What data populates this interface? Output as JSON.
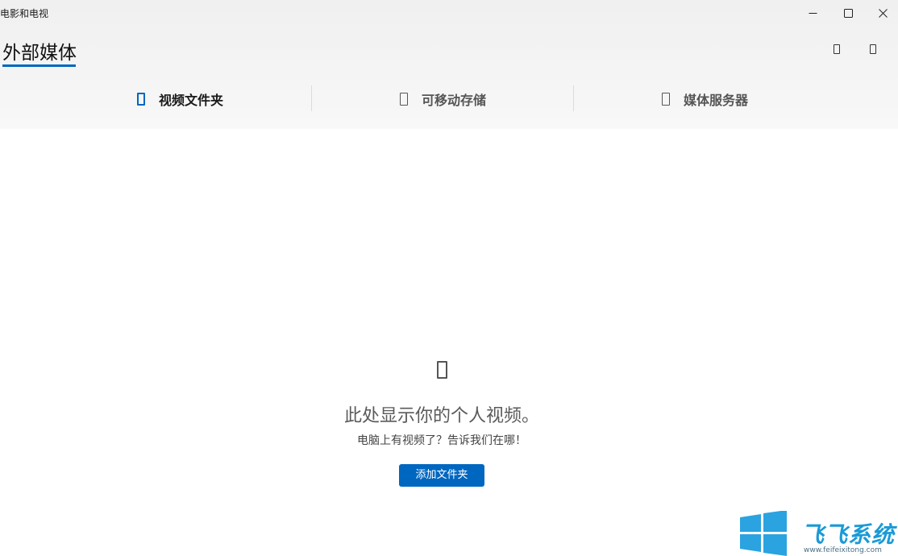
{
  "window": {
    "title": "电影和电视",
    "controls": [
      {
        "name": "minimize-icon"
      },
      {
        "name": "maximize-icon"
      },
      {
        "name": "close-icon"
      }
    ]
  },
  "header": {
    "title": "外部媒体",
    "actions": [
      {
        "name": "view-option-icon"
      },
      {
        "name": "more-option-icon"
      }
    ]
  },
  "tabs": [
    {
      "label": "视频文件夹",
      "active": true,
      "icon": "folder-icon"
    },
    {
      "label": "可移动存储",
      "active": false,
      "icon": "usb-storage-icon"
    },
    {
      "label": "媒体服务器",
      "active": false,
      "icon": "media-server-icon"
    }
  ],
  "empty_state": {
    "icon": "video-icon",
    "title": "此处显示你的个人视频。",
    "subtitle": "电脑上有视频了？告诉我们在哪！",
    "button_label": "添加文件夹"
  },
  "watermark": {
    "text": "飞飞系统",
    "url": "www.feifeixitong.com"
  },
  "colors": {
    "accent": "#0067c0",
    "watermark_blue": "#1a9ad6"
  }
}
